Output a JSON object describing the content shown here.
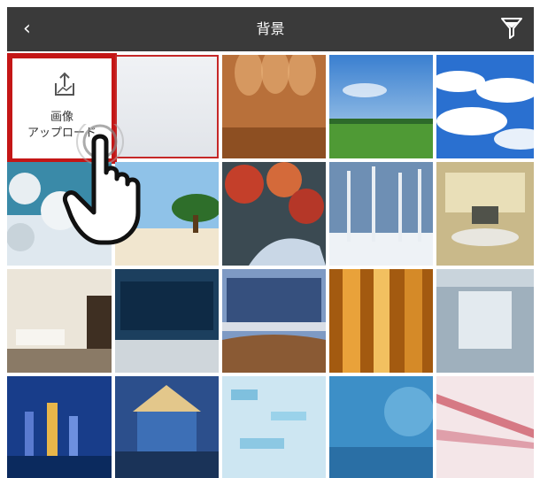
{
  "header": {
    "title": "背景",
    "back_icon": "chevron-left-icon",
    "filter_icon": "filter-funnel-icon",
    "background": "#3a3a3a"
  },
  "upload": {
    "label_line1": "画像",
    "label_line2": "アップロード",
    "icon": "upload-icon",
    "highlight_color": "#c41616"
  },
  "backgrounds": [
    {
      "name": "blank-white"
    },
    {
      "name": "wood-stage"
    },
    {
      "name": "green-field-sky"
    },
    {
      "name": "blue-sky-clouds"
    },
    {
      "name": "snowy-branches"
    },
    {
      "name": "beach-tree"
    },
    {
      "name": "autumn-stream"
    },
    {
      "name": "winter-forest"
    },
    {
      "name": "meeting-room"
    },
    {
      "name": "modern-living-room"
    },
    {
      "name": "studio-screen"
    },
    {
      "name": "news-desk-city"
    },
    {
      "name": "golden-glass-building"
    },
    {
      "name": "futuristic-corridor"
    },
    {
      "name": "night-city-bay"
    },
    {
      "name": "lit-building-night"
    },
    {
      "name": "blue-grid-abstract"
    },
    {
      "name": "tech-blue-abstract"
    },
    {
      "name": "light-speed-rays"
    }
  ],
  "cursor_icon": "pointing-hand-icon"
}
